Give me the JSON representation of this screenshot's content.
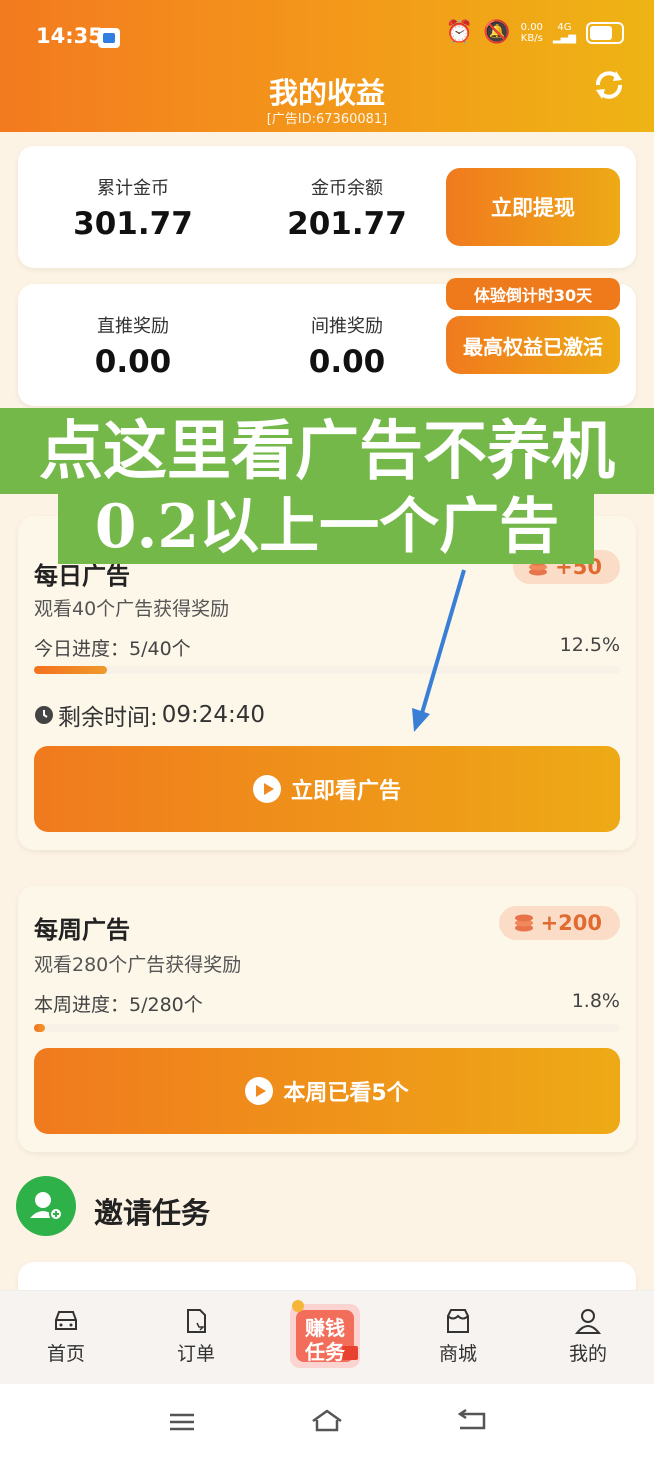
{
  "status": {
    "time": "14:35",
    "net_speed": "0.00",
    "net_unit": "KB/s",
    "net_type": "4G"
  },
  "header": {
    "title": "我的收益",
    "ad_id": "[广告ID:67360081]"
  },
  "summary": {
    "total_coins_label": "累计金币",
    "total_coins": "301.77",
    "balance_label": "金币余额",
    "balance": "201.77",
    "withdraw_button": "立即提现"
  },
  "rewards": {
    "direct_label": "直推奖励",
    "direct_value": "0.00",
    "indirect_label": "间推奖励",
    "indirect_value": "0.00",
    "countdown_badge": "体验倒计时30天",
    "rights_button": "最高权益已激活"
  },
  "overlay": {
    "line1": "点这里看广告不养机",
    "line2": "0.2以上一个广告"
  },
  "daily": {
    "title": "每日广告",
    "reward": "+50",
    "subtitle": "观看40个广告获得奖励",
    "progress_label": "今日进度：5/40个",
    "progress_pct": "12.5%",
    "progress": 0.125,
    "remaining_label": "剩余时间:",
    "remaining_time": "09:24:40",
    "watch_button": "立即看广告"
  },
  "weekly": {
    "title": "每周广告",
    "reward": "+200",
    "subtitle": "观看280个广告获得奖励",
    "progress_label": "本周进度：5/280个",
    "progress_pct": "1.8%",
    "progress": 0.018,
    "watch_button": "本周已看5个"
  },
  "invite": {
    "title": "邀请任务"
  },
  "tabbar": {
    "home": "首页",
    "orders": "订单",
    "center_line1": "赚钱",
    "center_line2": "任务",
    "mall": "商城",
    "mine": "我的"
  },
  "colors": {
    "accent": "#f07a1e",
    "accent_end": "#eeaa16",
    "overlay_green": "#75b84a",
    "invite_green": "#2fb14a"
  }
}
